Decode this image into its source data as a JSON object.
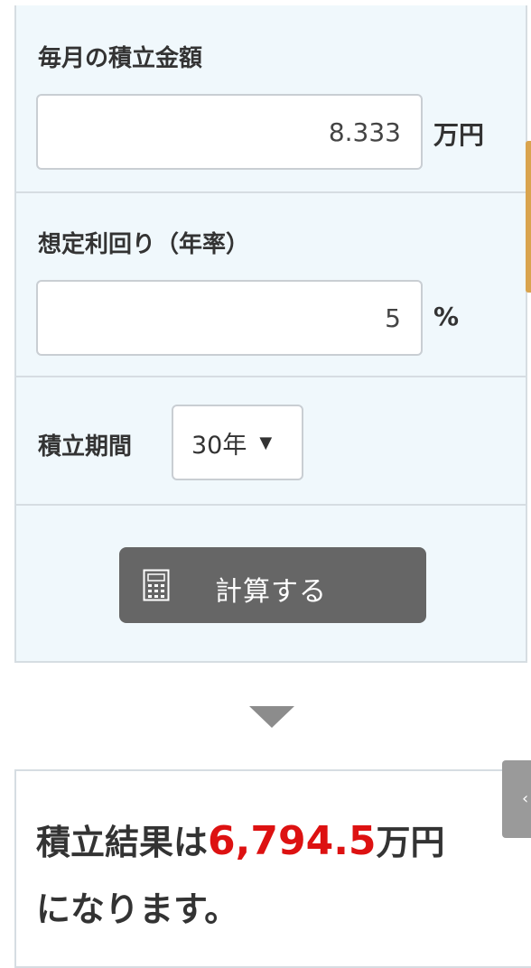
{
  "form": {
    "monthly": {
      "label": "毎月の積立金額",
      "value": "8.333",
      "unit": "万円"
    },
    "rate": {
      "label": "想定利回り（年率）",
      "value": "5",
      "unit": "%"
    },
    "period": {
      "label": "積立期間",
      "selected": "30年",
      "caret": "▼"
    },
    "calc_button": {
      "label": "計算する",
      "icon": "calculator-icon"
    }
  },
  "result": {
    "prefix": "積立結果は",
    "amount": "6,794.5",
    "suffix": "万円",
    "line2": "になります。",
    "amount_color": "#dd1111"
  },
  "side_tab": {
    "glyph": "‹"
  }
}
